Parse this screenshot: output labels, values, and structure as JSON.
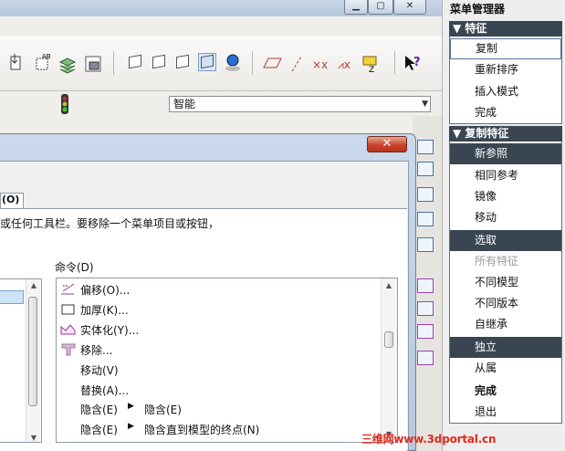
{
  "filter": {
    "value": "智能"
  },
  "dialog": {
    "tab_label": "(O)",
    "instruction": "或任何工具栏。要移除一个菜单项目或按钮，",
    "commands_label": "命令(D)",
    "close_glyph": "✕",
    "commands": [
      {
        "label": "偏移(O)...",
        "icon": "offset-icon"
      },
      {
        "label": "加厚(K)...",
        "icon": "thicken-icon"
      },
      {
        "label": "实体化(Y)...",
        "icon": "solidify-icon"
      },
      {
        "label": "移除...",
        "icon": "remove-icon"
      },
      {
        "label": "移动(V)",
        "icon": ""
      },
      {
        "label": "替换(A)...",
        "icon": ""
      },
      {
        "label": "隐含(E)",
        "sub": "隐含(E)",
        "icon": ""
      },
      {
        "label": "隐含(E)",
        "sub": "隐含直到模型的终点(N)",
        "icon": ""
      }
    ]
  },
  "menu_manager": {
    "title": "菜单管理器",
    "group1": {
      "header": "特征",
      "items": [
        "复制",
        "重新排序",
        "插入模式",
        "完成"
      ]
    },
    "group2": {
      "header": "复制特征",
      "items": [
        "新参照",
        "相同参考",
        "镜像",
        "移动",
        "选取",
        "所有特征",
        "不同模型",
        "不同版本",
        "自继承",
        "独立",
        "从属",
        "完成",
        "退出"
      ]
    }
  },
  "watermark": "三维网www.3dportal.cn",
  "colors": {
    "menu_dark": "#394652",
    "accent_blue": "#4a6fa8",
    "watermark_red": "#e02a1d",
    "close_red": "#c8452c"
  }
}
